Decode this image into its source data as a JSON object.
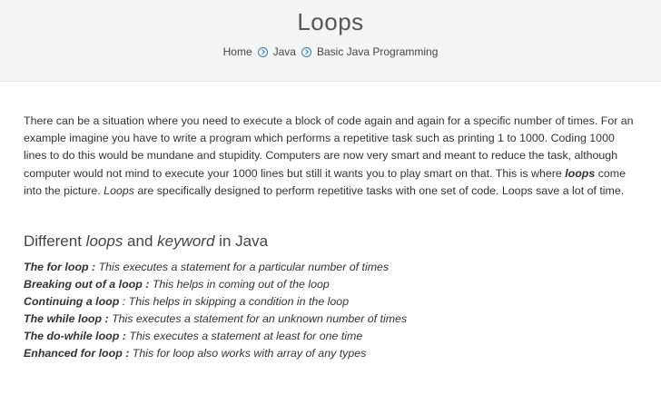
{
  "header": {
    "title": "Loops",
    "breadcrumb": [
      "Home",
      "Java",
      "Basic Java Programming"
    ]
  },
  "intro": {
    "p1": "There can be a situation where you need to execute a block of code again and again for a specific number of times. For an example imagine you have to write a program which performs a repetitive task such as printing 1 to 1000. Coding 1000 lines to do this would be mundane and stupidity. Computers are now very smart and meant to reduce the task, although computer would not mind to execute your 1000 lines but still it wants you to play smart on that. This is where ",
    "loops_bold": "loops",
    "p2": " come into the picture. ",
    "loops_italic": "Loops",
    "p3": " are specifically designed to perform repetitive tasks with one set of code. Loops save a lot of time."
  },
  "section": {
    "prefix": "Different ",
    "loops": "loops",
    "and": " and ",
    "keyword": "keyword",
    "suffix": " in Java"
  },
  "loops": [
    {
      "name": "The for loop :",
      "desc": " This executes a statement for a particular number of times"
    },
    {
      "name": "Breaking out of a loop :",
      "desc": " This helps in coming out of the loop"
    },
    {
      "name": "Continuing a loop",
      "desc": " : This helps in skipping a condition in the loop"
    },
    {
      "name": "The while loop :",
      "desc": " This executes a statement for an unknown number of times"
    },
    {
      "name": "The do-while loop :",
      "desc": " This executes a statement at least for one time"
    },
    {
      "name": "Enhanced for loop :",
      "desc": " This for loop also works with array of any types"
    }
  ],
  "colors": {
    "accent": "#2f7fb8",
    "header_bg": "#f4f4f4"
  }
}
